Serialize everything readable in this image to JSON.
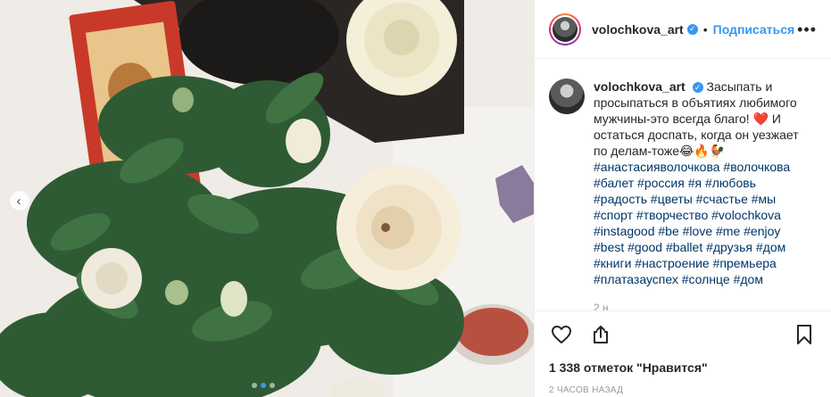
{
  "post": {
    "username": "volochkova_art",
    "follow_label": "Подписаться",
    "separator": "•",
    "more_glyph": "•••",
    "verified_glyph": "✓",
    "caption_text": "Засыпать и просыпаться в объятиях любимого мужчины-это всегда благо! ❤️ И остаться доспать, когда он уезжает по делам-тоже😂🔥🐓",
    "hashtags": "#анастасияволочкова #волочкова #балет #россия #я #любовь #радость #цветы #счастье #мы #спорт #творчество #volochkova #instagood #be #love #me #enjoy #best #good #ballet #друзья #дом #книги #настроение #премьера #платазауспех #солнце #дом",
    "more_comments": "2 н",
    "likes": "1 338 отметок \"Нравится\"",
    "time": "2 часов назад",
    "prev_glyph": "‹"
  },
  "carousel": {
    "slides": 3,
    "active": 2
  },
  "icons": [
    "like-icon",
    "share-icon",
    "save-icon",
    "prev-arrow-icon",
    "more-options-icon",
    "verified-icon"
  ],
  "colors": {
    "accent": "#3897f0",
    "hashtag": "#003569",
    "muted": "#999999",
    "text": "#262626"
  }
}
